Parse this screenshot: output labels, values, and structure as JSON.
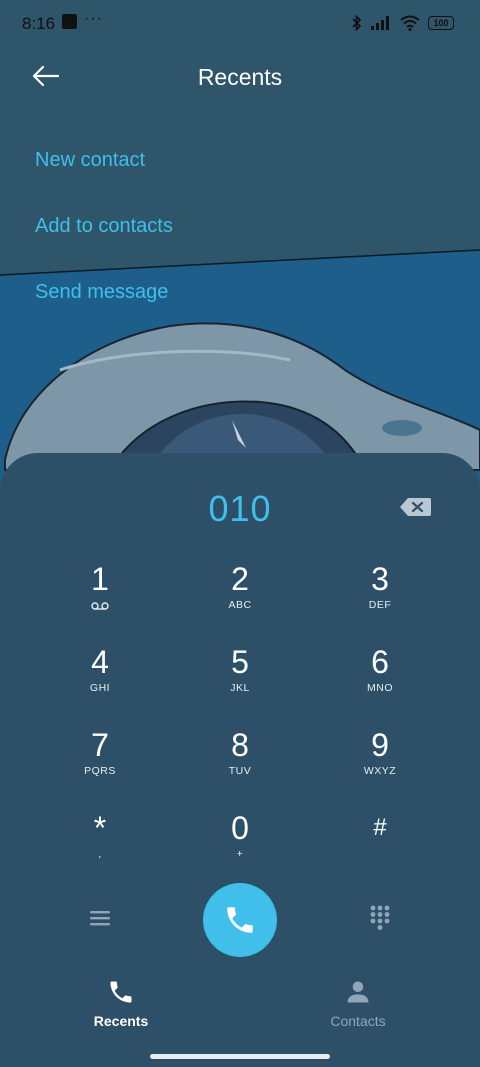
{
  "status_bar": {
    "time": "8:16",
    "more": "···",
    "battery": "100"
  },
  "header": {
    "title": "Recents"
  },
  "actions": [
    "New contact",
    "Add to contacts",
    "Send message"
  ],
  "dialer": {
    "number": "010"
  },
  "keys": [
    {
      "digit": "1",
      "letters": ""
    },
    {
      "digit": "2",
      "letters": "ABC"
    },
    {
      "digit": "3",
      "letters": "DEF"
    },
    {
      "digit": "4",
      "letters": "GHI"
    },
    {
      "digit": "5",
      "letters": "JKL"
    },
    {
      "digit": "6",
      "letters": "MNO"
    },
    {
      "digit": "7",
      "letters": "PQRS"
    },
    {
      "digit": "8",
      "letters": "TUV"
    },
    {
      "digit": "9",
      "letters": "WXYZ"
    },
    {
      "digit": "*",
      "letters": ","
    },
    {
      "digit": "0",
      "letters": "+"
    },
    {
      "digit": "#",
      "letters": ""
    }
  ],
  "tabs": [
    {
      "label": "Recents",
      "icon": "phone-icon",
      "active": true
    },
    {
      "label": "Contacts",
      "icon": "person-icon",
      "active": false
    }
  ],
  "colors": {
    "accent": "#3fbfea",
    "sheet": "#2d5068",
    "wallpaper": "#1d5f8a"
  }
}
